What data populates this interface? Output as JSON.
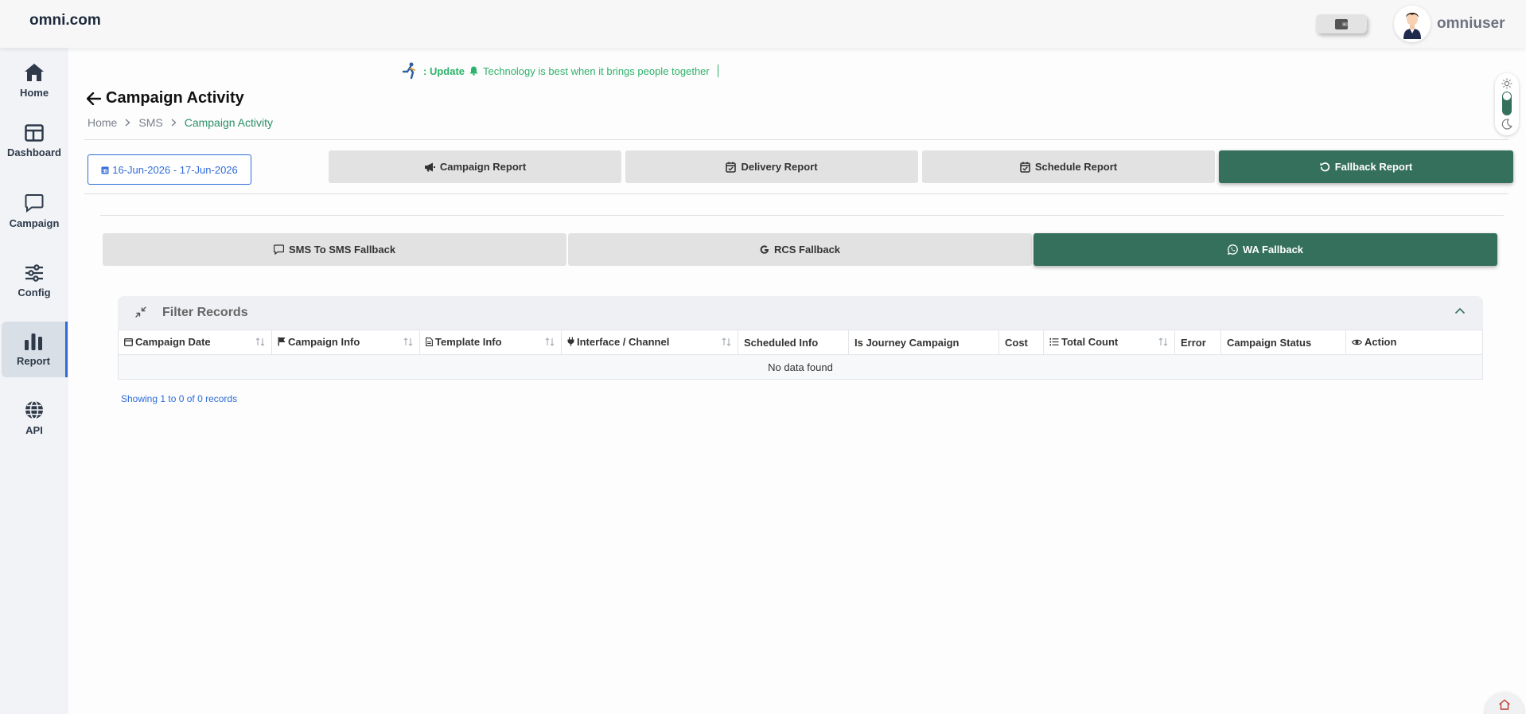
{
  "header": {
    "brand": "omni.com",
    "username": "omniuser"
  },
  "sidebar": {
    "items": [
      {
        "label": "Home",
        "icon": "home-icon"
      },
      {
        "label": "Dashboard",
        "icon": "dashboard-icon"
      },
      {
        "label": "Campaign",
        "icon": "chat-icon"
      },
      {
        "label": "Config",
        "icon": "sliders-icon"
      },
      {
        "label": "Report",
        "icon": "bar-chart-icon",
        "active": true
      },
      {
        "label": "API",
        "icon": "globe-icon"
      }
    ]
  },
  "ticker": {
    "prefix": ": Update",
    "message": "Technology is best when it brings people together"
  },
  "page": {
    "title": "Campaign Activity",
    "breadcrumb": [
      "Home",
      "SMS",
      "Campaign Activity"
    ]
  },
  "date_range": "16-Jun-2026 - 17-Jun-2026",
  "report_tabs": [
    {
      "label": "Campaign Report",
      "icon": "megaphone-icon"
    },
    {
      "label": "Delivery Report",
      "icon": "calendar-check-icon"
    },
    {
      "label": "Schedule Report",
      "icon": "calendar-check-icon"
    },
    {
      "label": "Fallback Report",
      "icon": "refresh-icon",
      "active": true
    }
  ],
  "fallback_tabs": [
    {
      "label": "SMS To SMS Fallback",
      "icon": "message-icon"
    },
    {
      "label": "RCS Fallback",
      "icon": "google-icon"
    },
    {
      "label": "WA Fallback",
      "icon": "whatsapp-icon",
      "active": true
    }
  ],
  "filter": {
    "title": "Filter Records"
  },
  "table": {
    "columns": [
      "Campaign Date",
      "Campaign Info",
      "Template Info",
      "Interface / Channel",
      "Scheduled Info",
      "Is Journey Campaign",
      "Cost",
      "Total Count",
      "Error",
      "Campaign Status",
      "Action"
    ],
    "empty_message": "No data found"
  },
  "pagination": {
    "summary": "Showing 1 to 0 of 0 records"
  },
  "colors": {
    "accent_green": "#35705c",
    "link_blue": "#2f6bd8",
    "ticker_green": "#2fb26b"
  }
}
